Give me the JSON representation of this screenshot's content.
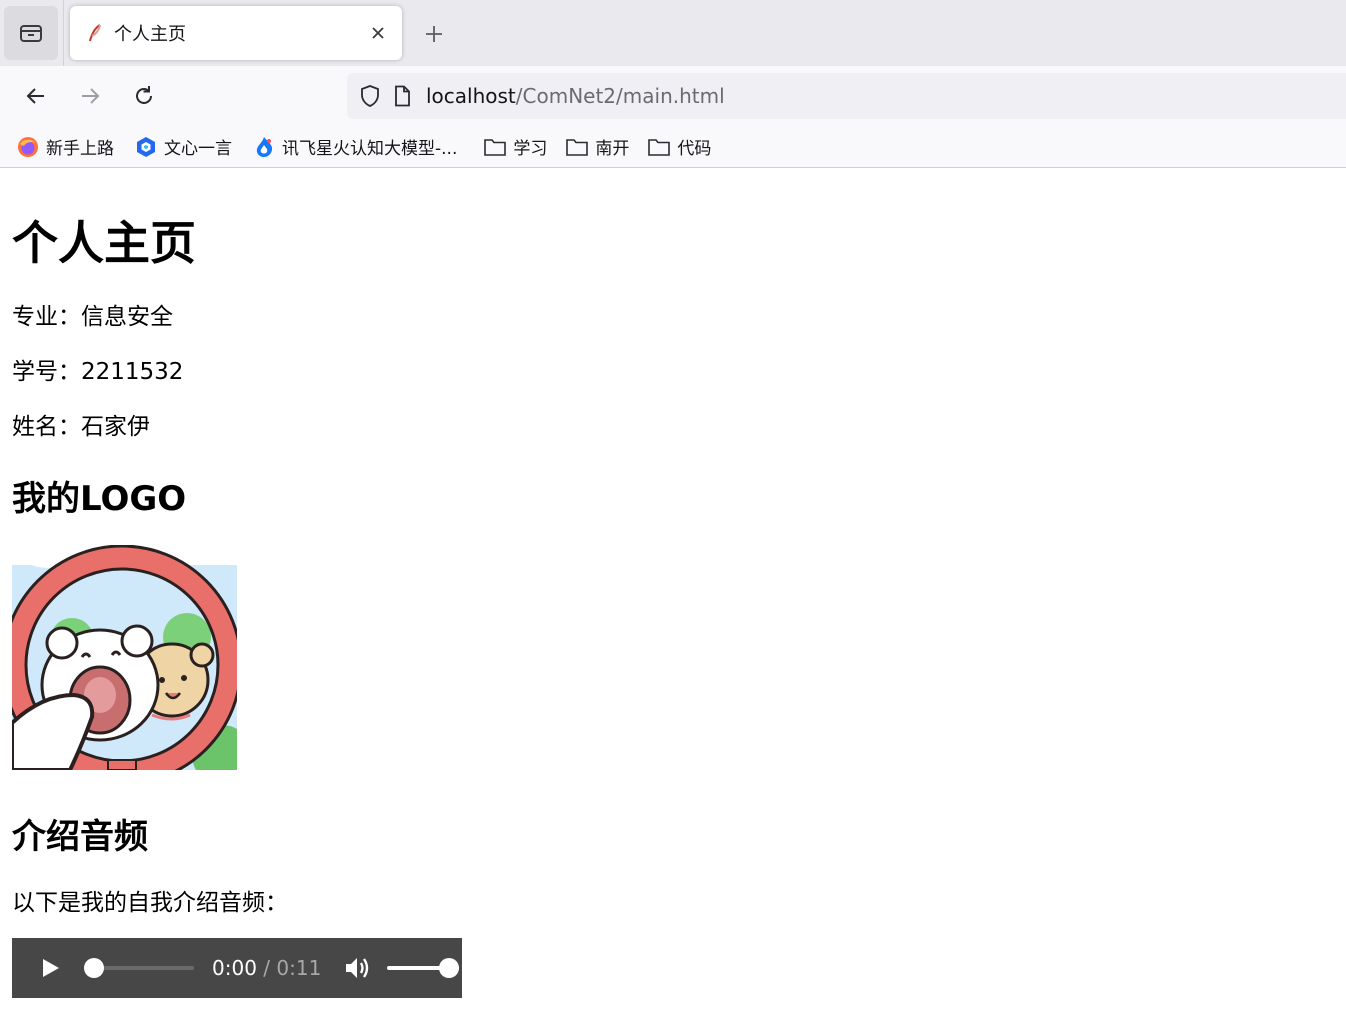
{
  "browser": {
    "tab": {
      "title": "个人主页",
      "favicon": "feather-icon"
    },
    "url": {
      "host": "localhost",
      "path": "/ComNet2/main.html"
    },
    "bookmarks": [
      {
        "label": "新手上路",
        "icon": "firefox-icon"
      },
      {
        "label": "文心一言",
        "icon": "ernie-bot-icon"
      },
      {
        "label": "讯飞星火认知大模型-...",
        "icon": "spark-flame-icon"
      },
      {
        "label": "学习",
        "icon": "folder-icon"
      },
      {
        "label": "南开",
        "icon": "folder-icon"
      },
      {
        "label": "代码",
        "icon": "folder-icon"
      }
    ]
  },
  "page": {
    "title": "个人主页",
    "major": "专业：信息安全",
    "student_id": "学号：2211532",
    "name": "姓名：石家伊",
    "logo_heading": "我的LOGO",
    "logo_image": "cartoon-dogs-logo",
    "audio_heading": "介绍音频",
    "audio_intro": "以下是我的自我介绍音频：",
    "audio": {
      "current_time": "0:00",
      "separator": "/",
      "duration": "0:11",
      "progress": 0,
      "volume": 1.0
    }
  },
  "colors": {
    "tabbar_bg": "#eae9ee",
    "toolbar_bg": "#f9f9fb",
    "urlbar_bg": "#f0f0f4",
    "audio_bg": "#474747"
  }
}
